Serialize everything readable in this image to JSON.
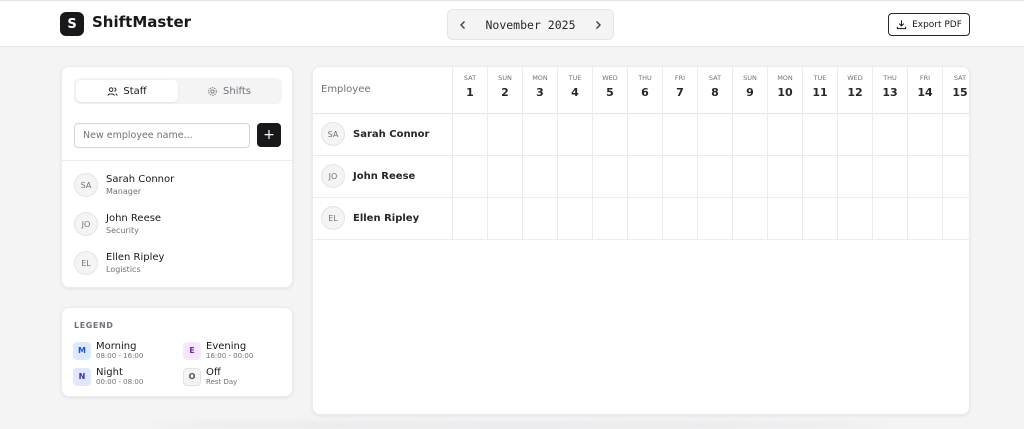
{
  "app": {
    "logo_letter": "S",
    "title": "ShiftMaster"
  },
  "month_nav": {
    "label": "November 2025",
    "prev_icon": "chevron-left-icon",
    "next_icon": "chevron-right-icon"
  },
  "export": {
    "label": "Export PDF",
    "icon": "download-icon"
  },
  "staff_panel": {
    "tabs": [
      {
        "label": "Staff",
        "icon": "users-icon",
        "active": true
      },
      {
        "label": "Shifts",
        "icon": "gear-icon",
        "active": false
      }
    ],
    "input_placeholder": "New employee name...",
    "add_label": "+",
    "employees": [
      {
        "initials": "SA",
        "name": "Sarah Connor",
        "role": "Manager"
      },
      {
        "initials": "JO",
        "name": "John Reese",
        "role": "Security"
      },
      {
        "initials": "EL",
        "name": "Ellen Ripley",
        "role": "Logistics"
      }
    ]
  },
  "legend": {
    "title": "LEGEND",
    "items": [
      {
        "code": "M",
        "name": "Morning",
        "time": "08:00 - 16:00",
        "bg": "#dbeafe",
        "fg": "#1d4ed8"
      },
      {
        "code": "E",
        "name": "Evening",
        "time": "16:00 - 00:00",
        "bg": "#f3e8ff",
        "fg": "#7e22ce"
      },
      {
        "code": "N",
        "name": "Night",
        "time": "00:00 - 08:00",
        "bg": "#e0e7ff",
        "fg": "#3730a3"
      },
      {
        "code": "O",
        "name": "Off",
        "time": "Rest Day",
        "bg": "#f4f4f5",
        "fg": "#52525b"
      }
    ]
  },
  "grid": {
    "employee_col_title": "Employee",
    "days": [
      {
        "name": "SAT",
        "num": "1"
      },
      {
        "name": "SUN",
        "num": "2"
      },
      {
        "name": "MON",
        "num": "3"
      },
      {
        "name": "TUE",
        "num": "4"
      },
      {
        "name": "WED",
        "num": "5"
      },
      {
        "name": "THU",
        "num": "6"
      },
      {
        "name": "FRI",
        "num": "7"
      },
      {
        "name": "SAT",
        "num": "8"
      },
      {
        "name": "SUN",
        "num": "9"
      },
      {
        "name": "MON",
        "num": "10"
      },
      {
        "name": "TUE",
        "num": "11"
      },
      {
        "name": "WED",
        "num": "12"
      },
      {
        "name": "THU",
        "num": "13"
      },
      {
        "name": "FRI",
        "num": "14"
      },
      {
        "name": "SAT",
        "num": "15"
      }
    ],
    "rows": [
      {
        "initials": "SA",
        "name": "Sarah Connor"
      },
      {
        "initials": "JO",
        "name": "John Reese"
      },
      {
        "initials": "EL",
        "name": "Ellen Ripley"
      }
    ]
  }
}
